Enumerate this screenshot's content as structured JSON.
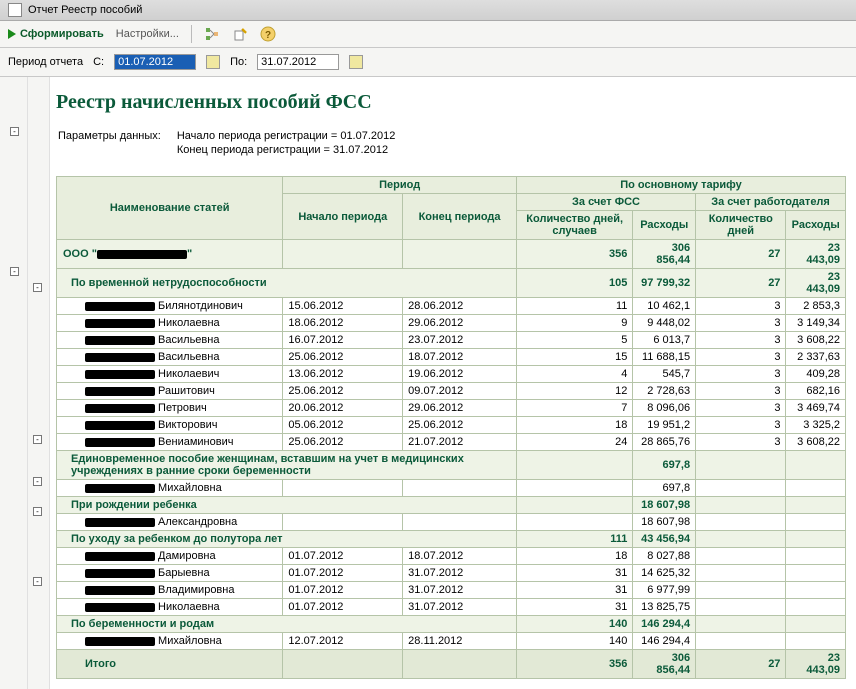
{
  "titlebar": {
    "text": "Отчет  Реестр пособий"
  },
  "toolbar": {
    "generate": "Сформировать",
    "settings": "Настройки..."
  },
  "period": {
    "label": "Период отчета",
    "from_label": "С:",
    "from_value": "01.07.2012",
    "to_label": "По:",
    "to_value": "31.07.2012"
  },
  "report": {
    "title": "Реестр начисленных пособий ФСС",
    "params_label": "Параметры данных:",
    "param1": "Начало периода регистрации = 01.07.2012",
    "param2": "Конец периода регистрации = 31.07.2012",
    "headers": {
      "col_name": "Наименование статей",
      "col_period": "Период",
      "col_start": "Начало периода",
      "col_end": "Конец периода",
      "col_main": "По основному тарифу",
      "col_fss": "За счет ФСС",
      "col_emp": "За счет работодателя",
      "col_days_cases": "Количество дней, случаев",
      "col_exp": "Расходы",
      "col_days": "Количество дней"
    },
    "company": {
      "prefix": "ООО \"",
      "suffix": "\"",
      "days": "356",
      "exp": "306 856,44",
      "d2": "27",
      "e2": "23 443,09"
    },
    "groups": [
      {
        "title": "По временной нетрудоспособности",
        "days": "105",
        "exp": "97 799,32",
        "d2": "27",
        "e2": "23 443,09",
        "rows": [
          {
            "patr": "Билянотдинович",
            "start": "15.06.2012",
            "end": "28.06.2012",
            "days": "11",
            "exp": "10 462,1",
            "d2": "3",
            "e2": "2 853,3"
          },
          {
            "patr": "Николаевна",
            "start": "18.06.2012",
            "end": "29.06.2012",
            "days": "9",
            "exp": "9 448,02",
            "d2": "3",
            "e2": "3 149,34"
          },
          {
            "patr": "Васильевна",
            "start": "16.07.2012",
            "end": "23.07.2012",
            "days": "5",
            "exp": "6 013,7",
            "d2": "3",
            "e2": "3 608,22"
          },
          {
            "patr": "Васильевна",
            "start": "25.06.2012",
            "end": "18.07.2012",
            "days": "15",
            "exp": "11 688,15",
            "d2": "3",
            "e2": "2 337,63"
          },
          {
            "patr": "Николаевич",
            "start": "13.06.2012",
            "end": "19.06.2012",
            "days": "4",
            "exp": "545,7",
            "d2": "3",
            "e2": "409,28"
          },
          {
            "patr": "Рашитович",
            "start": "25.06.2012",
            "end": "09.07.2012",
            "days": "12",
            "exp": "2 728,63",
            "d2": "3",
            "e2": "682,16"
          },
          {
            "patr": "Петрович",
            "start": "20.06.2012",
            "end": "29.06.2012",
            "days": "7",
            "exp": "8 096,06",
            "d2": "3",
            "e2": "3 469,74"
          },
          {
            "patr": "Викторович",
            "start": "05.06.2012",
            "end": "25.06.2012",
            "days": "18",
            "exp": "19 951,2",
            "d2": "3",
            "e2": "3 325,2"
          },
          {
            "patr": "Вениаминович",
            "start": "25.06.2012",
            "end": "21.07.2012",
            "days": "24",
            "exp": "28 865,76",
            "d2": "3",
            "e2": "3 608,22"
          }
        ]
      },
      {
        "title": "Единовременное пособие женщинам, вставшим на учет в медицинских учреждениях в ранние сроки беременности",
        "days": "",
        "exp": "697,8",
        "d2": "",
        "e2": "",
        "rows": [
          {
            "patr": "Михайловна",
            "start": "",
            "end": "",
            "days": "",
            "exp": "697,8",
            "d2": "",
            "e2": ""
          }
        ]
      },
      {
        "title": "При рождении ребенка",
        "days": "",
        "exp": "18 607,98",
        "d2": "",
        "e2": "",
        "rows": [
          {
            "patr": "Александровна",
            "start": "",
            "end": "",
            "days": "",
            "exp": "18 607,98",
            "d2": "",
            "e2": ""
          }
        ]
      },
      {
        "title": "По уходу за ребенком до полутора лет",
        "days": "111",
        "exp": "43 456,94",
        "d2": "",
        "e2": "",
        "rows": [
          {
            "patr": "Дамировна",
            "start": "01.07.2012",
            "end": "18.07.2012",
            "days": "18",
            "exp": "8 027,88",
            "d2": "",
            "e2": ""
          },
          {
            "patr": "Барыевна",
            "start": "01.07.2012",
            "end": "31.07.2012",
            "days": "31",
            "exp": "14 625,32",
            "d2": "",
            "e2": ""
          },
          {
            "patr": "Владимировна",
            "start": "01.07.2012",
            "end": "31.07.2012",
            "days": "31",
            "exp": "6 977,99",
            "d2": "",
            "e2": ""
          },
          {
            "patr": "Николаевна",
            "start": "01.07.2012",
            "end": "31.07.2012",
            "days": "31",
            "exp": "13 825,75",
            "d2": "",
            "e2": ""
          }
        ]
      },
      {
        "title": "По беременности и родам",
        "days": "140",
        "exp": "146 294,4",
        "d2": "",
        "e2": "",
        "rows": [
          {
            "patr": "Михайловна",
            "start": "12.07.2012",
            "end": "28.11.2012",
            "days": "140",
            "exp": "146 294,4",
            "d2": "",
            "e2": ""
          }
        ]
      }
    ],
    "total": {
      "label": "Итого",
      "days": "356",
      "exp": "306 856,44",
      "d2": "27",
      "e2": "23 443,09"
    }
  }
}
